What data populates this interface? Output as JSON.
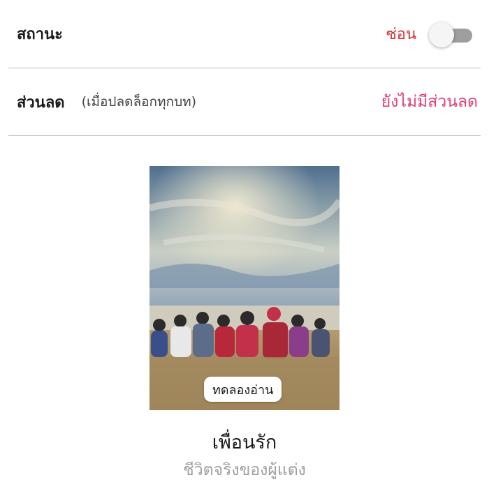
{
  "status": {
    "label": "สถานะ",
    "value": "ซ่อน",
    "toggle_on": false
  },
  "discount": {
    "label": "ส่วนลด",
    "note": "(เมื่อปลดล็อกทุกบท)",
    "value": "ยังไม่มีส่วนลด"
  },
  "book": {
    "trial_label": "ทดลองอ่าน",
    "title": "เพื่อนรัก",
    "author": "ชีวิตจริงของผู้แต่ง"
  },
  "colors": {
    "status_red": "#d32f2f",
    "discount_pink": "#e0407a",
    "divider": "#bdbdbd",
    "author_gray": "#9e9e9e"
  }
}
